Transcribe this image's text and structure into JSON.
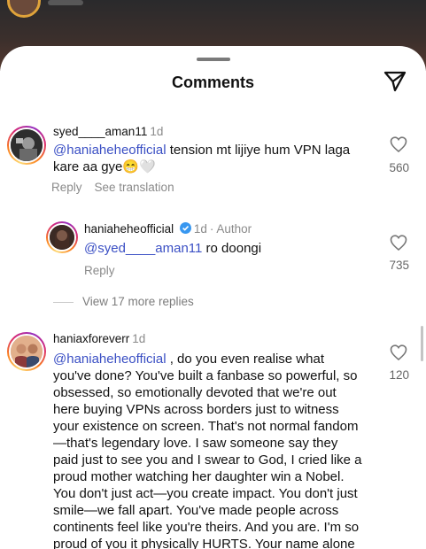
{
  "header": {
    "title": "Comments",
    "send_icon": "paper-plane-icon"
  },
  "comments": [
    {
      "username": "syed____aman11",
      "time": "1d",
      "mention": "@haniahehe​official",
      "text": " tension mt lijiye hum VPN laga kare aa gye😁🤍",
      "likes": "560",
      "reply_label": "Reply",
      "translate_label": "See translation"
    },
    {
      "username": "haniahehe​official",
      "time": "1d",
      "author_label": "· Author",
      "mention": "@syed____aman11",
      "text": " ro doongi",
      "likes": "735",
      "reply_label": "Reply",
      "view_more": "View 17 more replies"
    },
    {
      "username": "haniaxforeverr",
      "time": "1d",
      "mention": "@haniahehe​official",
      "text": " , do you even realise what you've done? You've built a fanbase so powerful, so obsessed, so emotionally devoted that we're out here buying VPNs across borders just to witness your existence on screen. That's not normal fandom—that's legendary love. I saw someone say they paid just to see you and I swear to God, I cried like a proud mother watching her daughter win a Nobel. You don't just act—you create impact. You don't just smile—we fall apart. You've made people across continents feel like you're theirs. And you are. I'm so proud of you it physically HURTS. Your name alone carries a",
      "likes": "120"
    }
  ],
  "colors": {
    "mention": "#3a4fc4",
    "meta": "#8a8a8a",
    "verified": "#3897f0"
  }
}
